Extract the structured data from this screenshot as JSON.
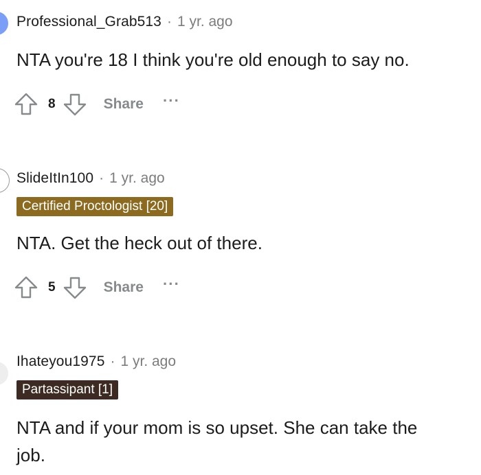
{
  "comments": [
    {
      "username": "Professional_Grab513",
      "separator": "·",
      "time": "1 yr. ago",
      "flair": null,
      "body_lines": [
        "NTA you're 18 I think you're old enough to say no."
      ],
      "score": "8",
      "share_label": "Share",
      "more_label": "···",
      "avatar_color": "#7b9ff7"
    },
    {
      "username": "SlideItIn100",
      "separator": "·",
      "time": "1 yr. ago",
      "flair": "Certified Proctologist [20]",
      "flair_color": "#8c6a1f",
      "body_lines": [
        "NTA. Get the heck out of there."
      ],
      "score": "5",
      "share_label": "Share",
      "more_label": "···",
      "avatar_color": "#ffffff"
    },
    {
      "username": "Ihateyou1975",
      "separator": "·",
      "time": "1 yr. ago",
      "flair": "Partassipant [1]",
      "flair_color": "#3d2a22",
      "body_lines": [
        "NTA and if your mom is so upset. She can take the",
        "job."
      ],
      "avatar_color": "#eeeeee"
    }
  ],
  "colors": {
    "text": "#1c1c1c",
    "meta": "#7c7c7c",
    "action": "#878a8c",
    "icon_stroke": "#878a8c"
  },
  "icons": {
    "upvote": "arrow-up-outline-icon",
    "downvote": "arrow-down-outline-icon",
    "more": "ellipsis-icon"
  }
}
